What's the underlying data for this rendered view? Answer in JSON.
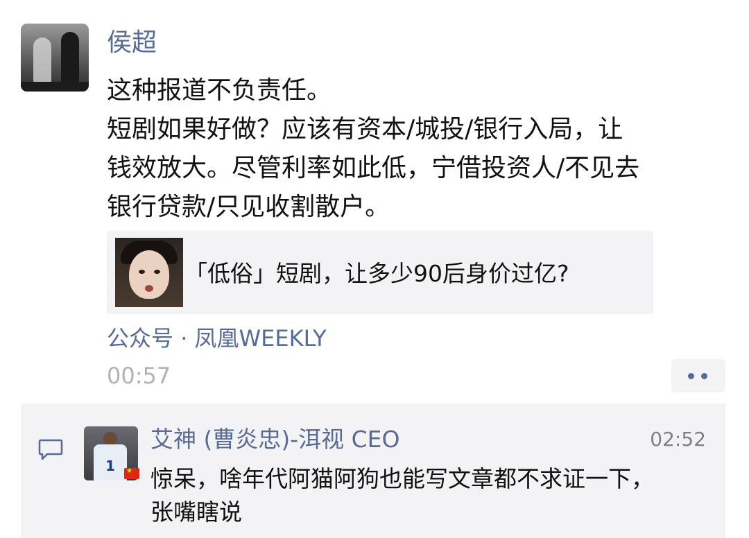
{
  "post": {
    "author": "侯超",
    "body_lines": [
      "这种报道不负责任。",
      "短剧如果好做？应该有资本/城投/银行入局，让",
      "钱效放大。尽管利率如此低，宁借投资人/不见去",
      "银行贷款/只见收割散户。"
    ],
    "link_card": {
      "title": "「低俗」短剧，让多少90后身价过亿?"
    },
    "source": "公众号 · 凤凰WEEKLY",
    "time": "00:57",
    "more_icon": "more-dots-icon"
  },
  "comments": [
    {
      "icon": "comment-bubble-icon",
      "author": "艾神 (曹炎忠)-洱视 CEO",
      "time": "02:52",
      "text_lines": [
        "惊呆，啥年代阿猫阿狗也能写文章都不求证一下，",
        "张嘴瞎说"
      ],
      "avatar_jersey_number": "1"
    }
  ],
  "colors": {
    "link_blue": "#576b95",
    "text": "#111111",
    "muted": "#b2b2b2",
    "panel_bg": "#f3f3f5"
  }
}
